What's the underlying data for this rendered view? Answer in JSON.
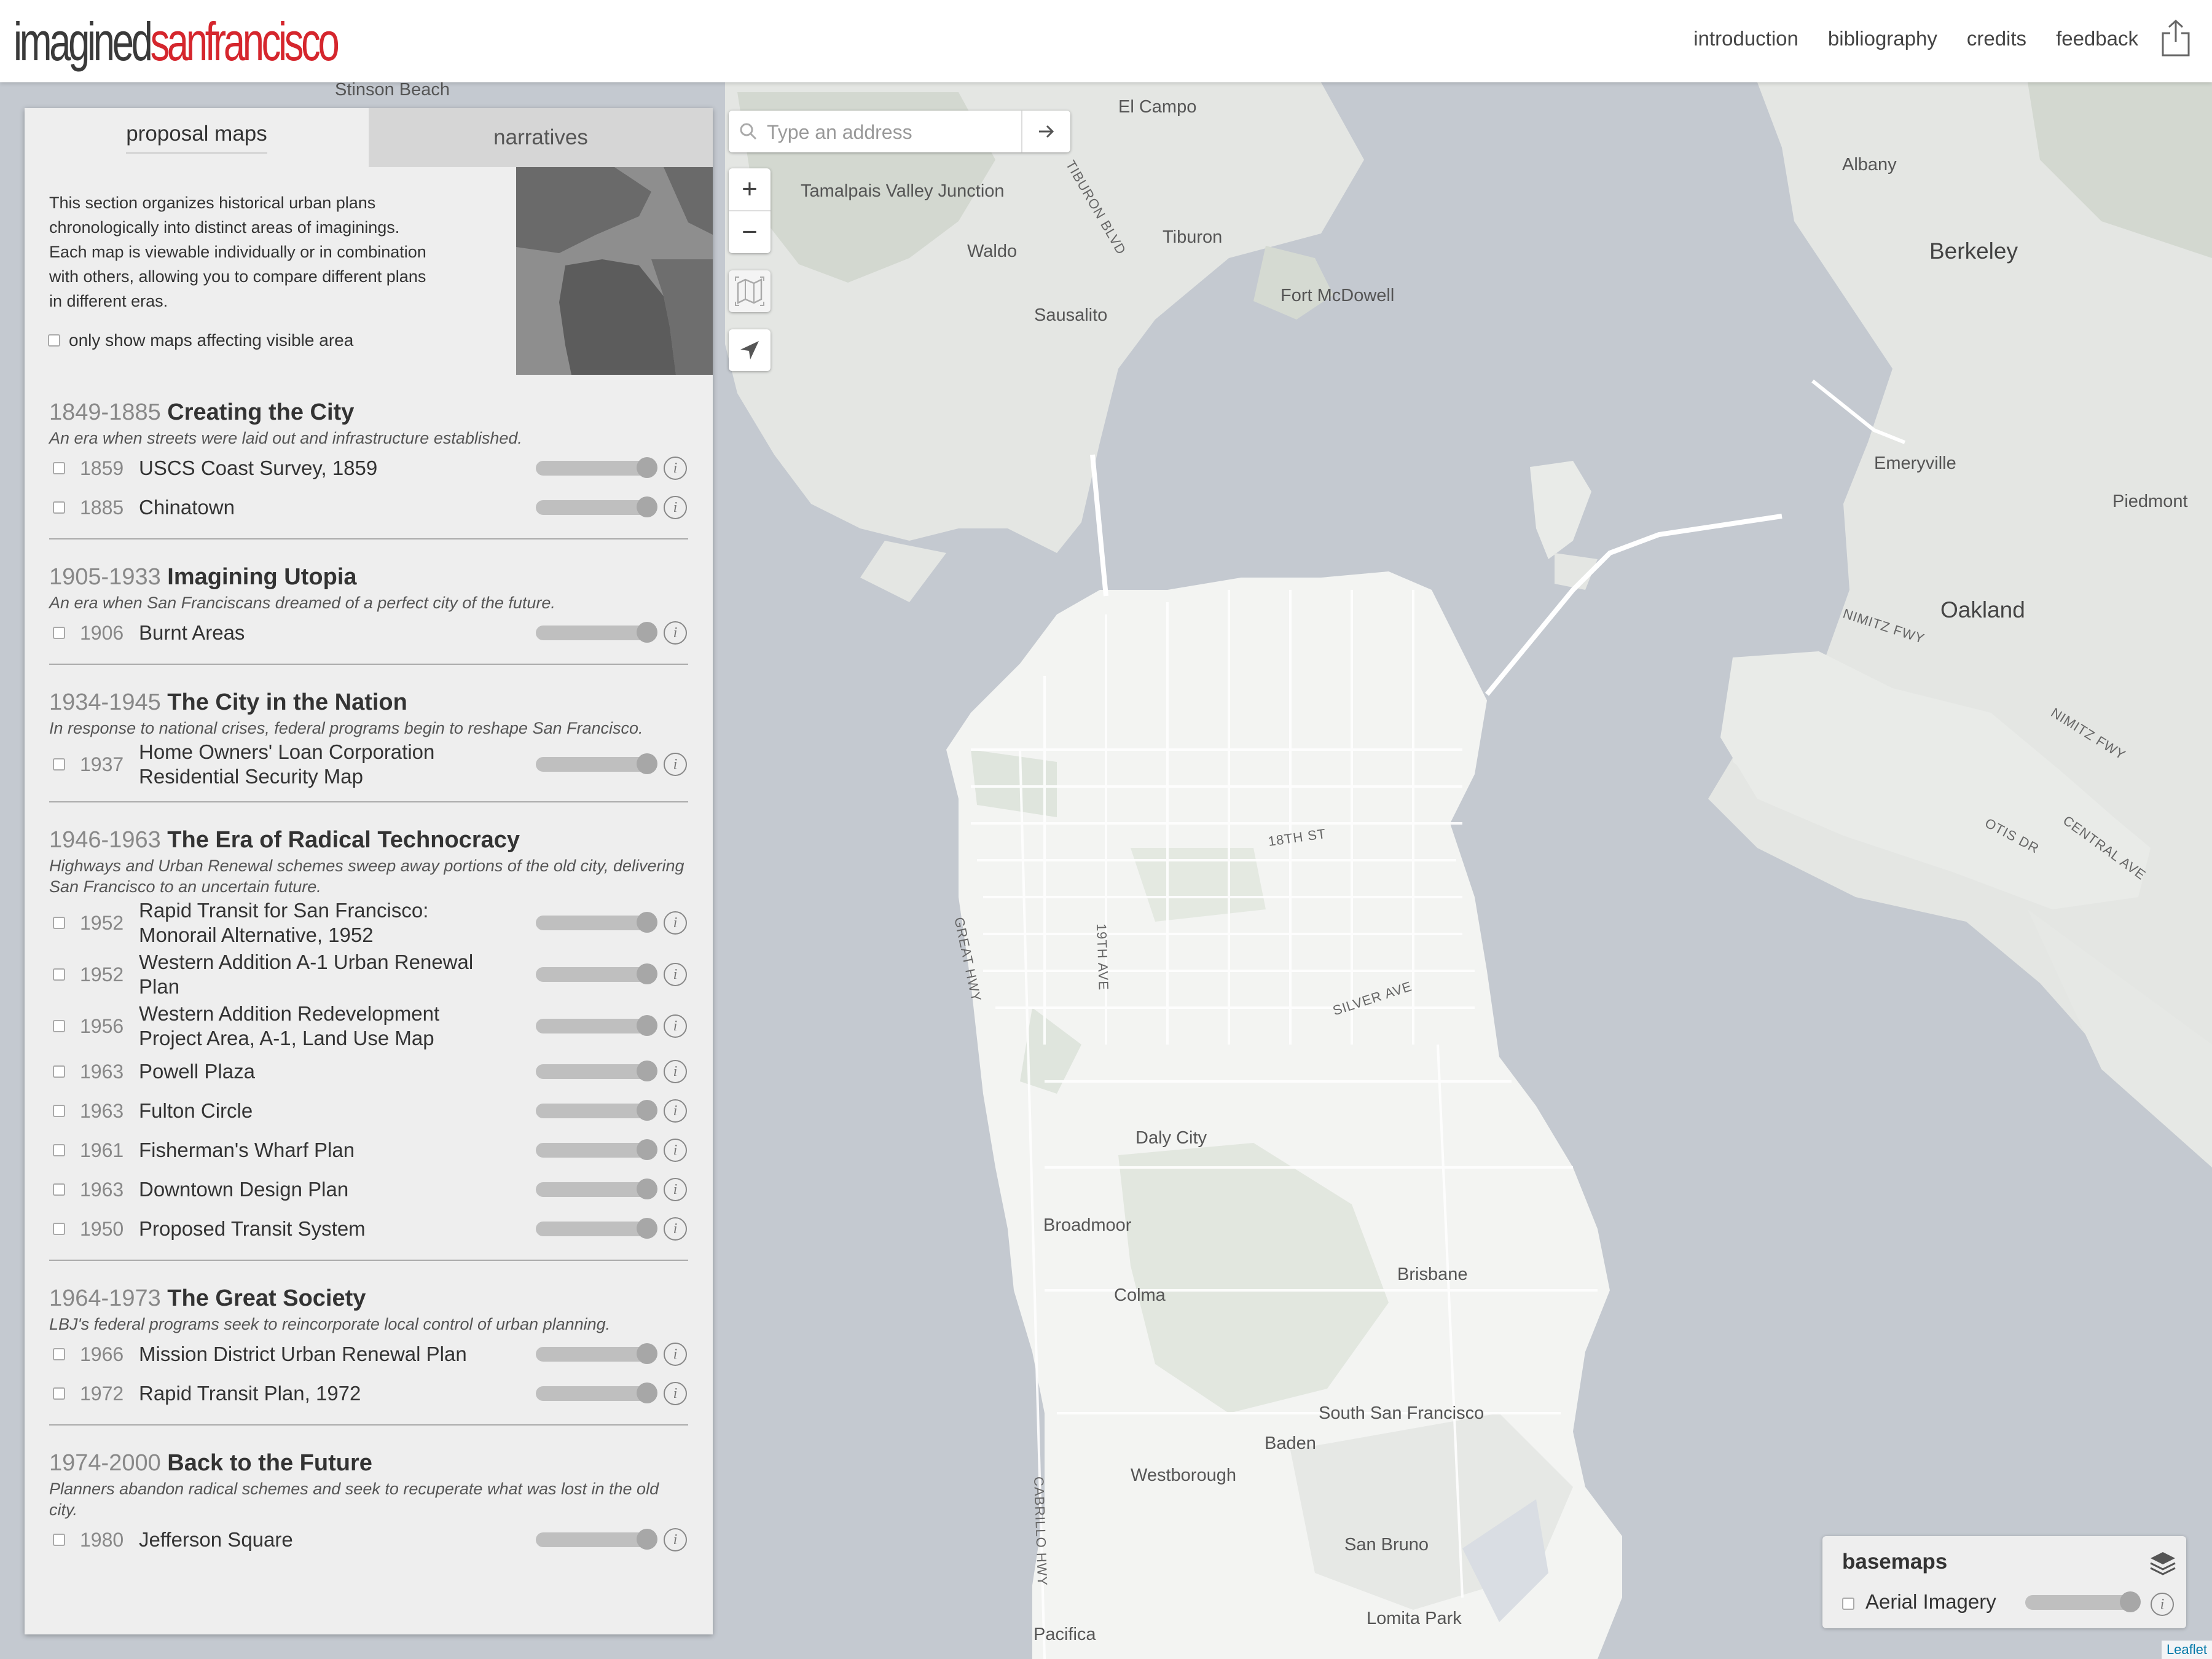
{
  "header": {
    "logo_part1": "imagined",
    "logo_part2": "sanfrancisco",
    "nav": [
      "introduction",
      "bibliography",
      "credits",
      "feedback"
    ]
  },
  "search": {
    "placeholder": "Type an address"
  },
  "controls": {
    "zoom_in": "+",
    "zoom_out": "−"
  },
  "sidebar": {
    "tabs": [
      "proposal maps",
      "narratives"
    ],
    "intro": "This section organizes historical urban plans chronologically into distinct areas of imaginings.  Each map is viewable individually or in combination with others, allowing you to compare different plans in different eras.",
    "filter_label": "only show maps affecting visible area",
    "eras": [
      {
        "years": "1849-1885",
        "name": "Creating the City",
        "desc": "An era when streets were laid out and infrastructure established.",
        "items": [
          {
            "year": "1859",
            "name": "USCS Coast Survey, 1859"
          },
          {
            "year": "1885",
            "name": "Chinatown"
          }
        ]
      },
      {
        "years": "1905-1933",
        "name": "Imagining Utopia",
        "desc": "An era when San Franciscans dreamed of a perfect city of the future.",
        "items": [
          {
            "year": "1906",
            "name": "Burnt Areas"
          }
        ]
      },
      {
        "years": "1934-1945",
        "name": "The City in the Nation",
        "desc": "In response to national crises, federal programs begin to reshape San Francisco.",
        "items": [
          {
            "year": "1937",
            "name": "Home Owners' Loan Corporation Residential Security Map"
          }
        ]
      },
      {
        "years": "1946-1963",
        "name": "The Era of Radical Technocracy",
        "desc": "Highways and Urban Renewal schemes sweep away portions of the old city, delivering San Francisco to an uncertain future.",
        "items": [
          {
            "year": "1952",
            "name": "Rapid Transit for San Francisco: Monorail Alternative, 1952"
          },
          {
            "year": "1952",
            "name": "Western Addition A-1 Urban Renewal Plan"
          },
          {
            "year": "1956",
            "name": "Western Addition Redevelopment Project Area, A-1, Land Use Map"
          },
          {
            "year": "1963",
            "name": "Powell Plaza"
          },
          {
            "year": "1963",
            "name": "Fulton Circle"
          },
          {
            "year": "1961",
            "name": "Fisherman's Wharf Plan"
          },
          {
            "year": "1963",
            "name": "Downtown Design Plan"
          },
          {
            "year": "1950",
            "name": "Proposed Transit System"
          }
        ]
      },
      {
        "years": "1964-1973",
        "name": "The Great Society",
        "desc": "LBJ's federal programs seek to reincorporate local control of urban planning.",
        "items": [
          {
            "year": "1966",
            "name": "Mission District Urban Renewal Plan"
          },
          {
            "year": "1972",
            "name": "Rapid Transit Plan, 1972"
          }
        ]
      },
      {
        "years": "1974-2000",
        "name": "Back to the Future",
        "desc": "Planners abandon radical schemes and seek to recuperate what was lost in the old city.",
        "items": [
          {
            "year": "1980",
            "name": "Jefferson Square"
          }
        ]
      }
    ]
  },
  "basemaps": {
    "title": "basemaps",
    "layer": "Aerial Imagery"
  },
  "attribution": "Leaflet",
  "map_places": [
    {
      "name": "Stinson Beach",
      "cls": "place"
    },
    {
      "name": "El Campo",
      "cls": "place"
    },
    {
      "name": "Tamalpais Valley Junction",
      "cls": "place"
    },
    {
      "name": "Tiburon",
      "cls": "place"
    },
    {
      "name": "Waldo",
      "cls": "place"
    },
    {
      "name": "Sausalito",
      "cls": "place"
    },
    {
      "name": "Fort McDowell",
      "cls": "place"
    },
    {
      "name": "Albany",
      "cls": "place"
    },
    {
      "name": "Berkeley",
      "cls": "place big"
    },
    {
      "name": "Emeryville",
      "cls": "place"
    },
    {
      "name": "Piedmont",
      "cls": "place"
    },
    {
      "name": "Oakland",
      "cls": "place big"
    },
    {
      "name": "NIMITZ FWY",
      "cls": "road"
    },
    {
      "name": "NIMITZ FWY",
      "cls": "road"
    },
    {
      "name": "OTIS DR",
      "cls": "road"
    },
    {
      "name": "CENTRAL AVE",
      "cls": "road"
    },
    {
      "name": "TIBURON BLVD",
      "cls": "road"
    },
    {
      "name": "18TH ST",
      "cls": "road"
    },
    {
      "name": "GREAT HWY",
      "cls": "road"
    },
    {
      "name": "19TH AVE",
      "cls": "road"
    },
    {
      "name": "SILVER AVE",
      "cls": "road"
    },
    {
      "name": "Daly City",
      "cls": "place"
    },
    {
      "name": "Broadmoor",
      "cls": "place"
    },
    {
      "name": "Colma",
      "cls": "place"
    },
    {
      "name": "Brisbane",
      "cls": "place"
    },
    {
      "name": "South San Francisco",
      "cls": "place"
    },
    {
      "name": "Baden",
      "cls": "place"
    },
    {
      "name": "Westborough",
      "cls": "place"
    },
    {
      "name": "CABRILLO HWY",
      "cls": "road"
    },
    {
      "name": "San Bruno",
      "cls": "place"
    },
    {
      "name": "Lomita Park",
      "cls": "place"
    },
    {
      "name": "Pacifica",
      "cls": "place"
    }
  ]
}
